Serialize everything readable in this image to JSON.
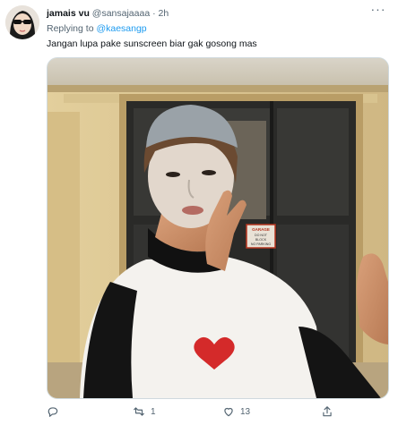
{
  "tweet": {
    "display_name": "jamais vu",
    "handle": "@sansajaaaa",
    "separator": "·",
    "time": "2h",
    "replying_prefix": "Replying to",
    "replying_to": "@kaesangp",
    "text": "Jangan lupa pake sunscreen biar gak gosong mas",
    "more_label": "···",
    "media": {
      "sign_line1": "GARAGE",
      "sign_line2": "DO NOT",
      "sign_line3": "BLOCK",
      "sign_line4": "NO PARKING"
    }
  },
  "actions": {
    "reply_count": "",
    "retweet_count": "1",
    "like_count": "13",
    "share_count": ""
  },
  "icons": {
    "reply": "reply-icon",
    "retweet": "retweet-icon",
    "like": "heart-icon",
    "share": "share-icon",
    "more": "more-options-icon"
  },
  "colors": {
    "link": "#1d9bf0",
    "secondary_text": "#536471",
    "primary_text": "#0f1419"
  }
}
